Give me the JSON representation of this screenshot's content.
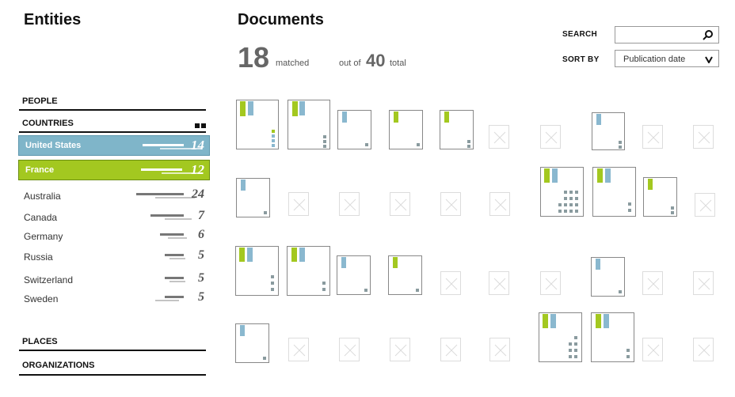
{
  "entities_title": "Entities",
  "documents_title": "Documents",
  "stats": {
    "matched_count": "18",
    "matched_label": "matched",
    "out_of_label": "out of",
    "total_count": "40",
    "total_label": "total"
  },
  "controls": {
    "search_label": "SEARCH",
    "search_value": "",
    "sort_label": "SORT BY",
    "sort_value": "Publication date"
  },
  "sections": {
    "people": "PEOPLE",
    "countries": "COUNTRIES",
    "places": "PLACES",
    "organizations": "ORGANIZATIONS"
  },
  "selected_countries": [
    {
      "name": "United States",
      "count": "14",
      "color": "#7fb5c9"
    },
    {
      "name": "France",
      "count": "12",
      "color": "#a3c820"
    }
  ],
  "countries": [
    {
      "name": "Australia",
      "count": "24"
    },
    {
      "name": "Canada",
      "count": "7"
    },
    {
      "name": "Germany",
      "count": "6"
    },
    {
      "name": "Russia",
      "count": "5"
    },
    {
      "name": "Switzerland",
      "count": "5"
    },
    {
      "name": "Sweden",
      "count": "5"
    }
  ],
  "colors": {
    "green": "#a3c820",
    "blue": "#8ab8cf",
    "gray": "#8a9b9f"
  }
}
